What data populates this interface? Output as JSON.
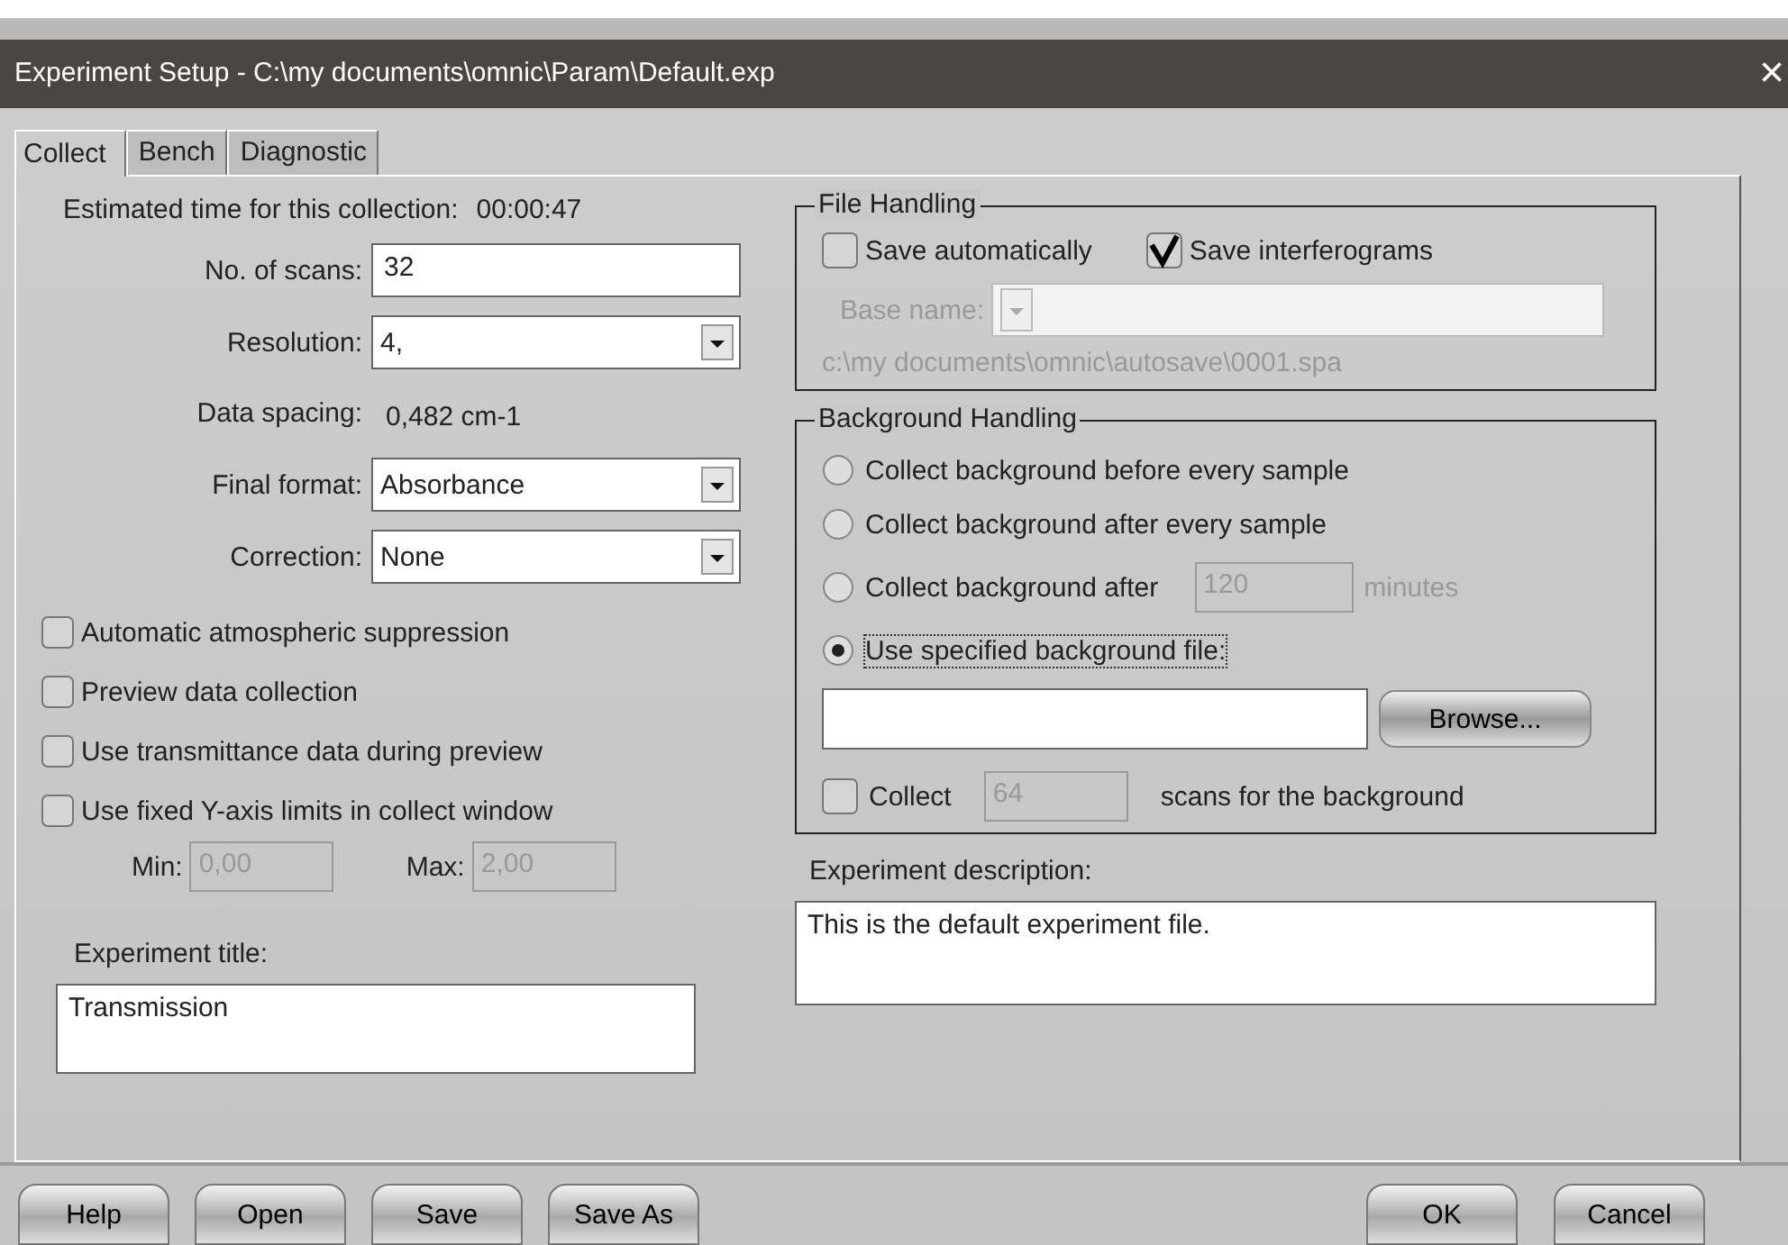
{
  "window": {
    "title": "Experiment Setup - C:\\my documents\\omnic\\Param\\Default.exp",
    "close": "×"
  },
  "tabs": [
    {
      "label": "Collect",
      "selected": true
    },
    {
      "label": "Bench",
      "selected": false
    },
    {
      "label": "Diagnostic",
      "selected": false
    }
  ],
  "estimate": {
    "label": "Estimated time for this collection:",
    "value": "00:00:47"
  },
  "fields": [
    {
      "kind": "input",
      "label": "No. of scans:",
      "value": "32"
    },
    {
      "kind": "dropdown",
      "label": "Resolution:",
      "value": "4,"
    },
    {
      "kind": "readout",
      "label": "Data spacing:",
      "value": "0,482 cm-1"
    },
    {
      "kind": "dropdown",
      "label": "Final format:",
      "value": "Absorbance"
    },
    {
      "kind": "dropdown",
      "label": "Correction:",
      "value": "None"
    }
  ],
  "options": [
    {
      "label": "Automatic atmospheric suppression",
      "checked": false
    },
    {
      "label": "Preview data collection",
      "checked": false
    },
    {
      "label": "Use transmittance data during preview",
      "checked": false
    },
    {
      "label": "Use fixed Y-axis limits in collect window",
      "checked": false
    }
  ],
  "limits": [
    {
      "label": "Min:",
      "value": "0,00",
      "disabled": true
    },
    {
      "label": "Max:",
      "value": "2,00",
      "disabled": true
    }
  ],
  "experiment_title": {
    "label": "Experiment title:",
    "value": "Transmission"
  },
  "file_handling": {
    "title": "File Handling",
    "options": [
      {
        "label": "Save automatically",
        "checked": false
      },
      {
        "label": "Save interferograms",
        "checked": true
      }
    ],
    "base_name": {
      "label": "Base name:",
      "disabled": true
    },
    "path": "c:\\my documents\\omnic\\autosave\\0001.spa"
  },
  "background_handling": {
    "title": "Background Handling",
    "radios": [
      {
        "kind": "plain",
        "label": "Collect background before every sample",
        "selected": false
      },
      {
        "kind": "plain",
        "label": "Collect background after every sample",
        "selected": false
      },
      {
        "kind": "minutes",
        "label": "Collect background after",
        "value": "120",
        "unit": "minutes",
        "disabled": true,
        "selected": false
      },
      {
        "kind": "plain",
        "label": "Use specified background file:",
        "selected": true
      }
    ],
    "browse": "Browse...",
    "collect": {
      "label": "Collect",
      "checked": false,
      "value": "64",
      "disabled": true,
      "suffix": "scans for the background"
    }
  },
  "description": {
    "label": "Experiment description:",
    "value": "This is the default experiment file."
  },
  "file_buttons": [
    "Help",
    "Open",
    "Save",
    "Save As"
  ],
  "dialog_buttons": [
    "OK",
    "Cancel"
  ]
}
